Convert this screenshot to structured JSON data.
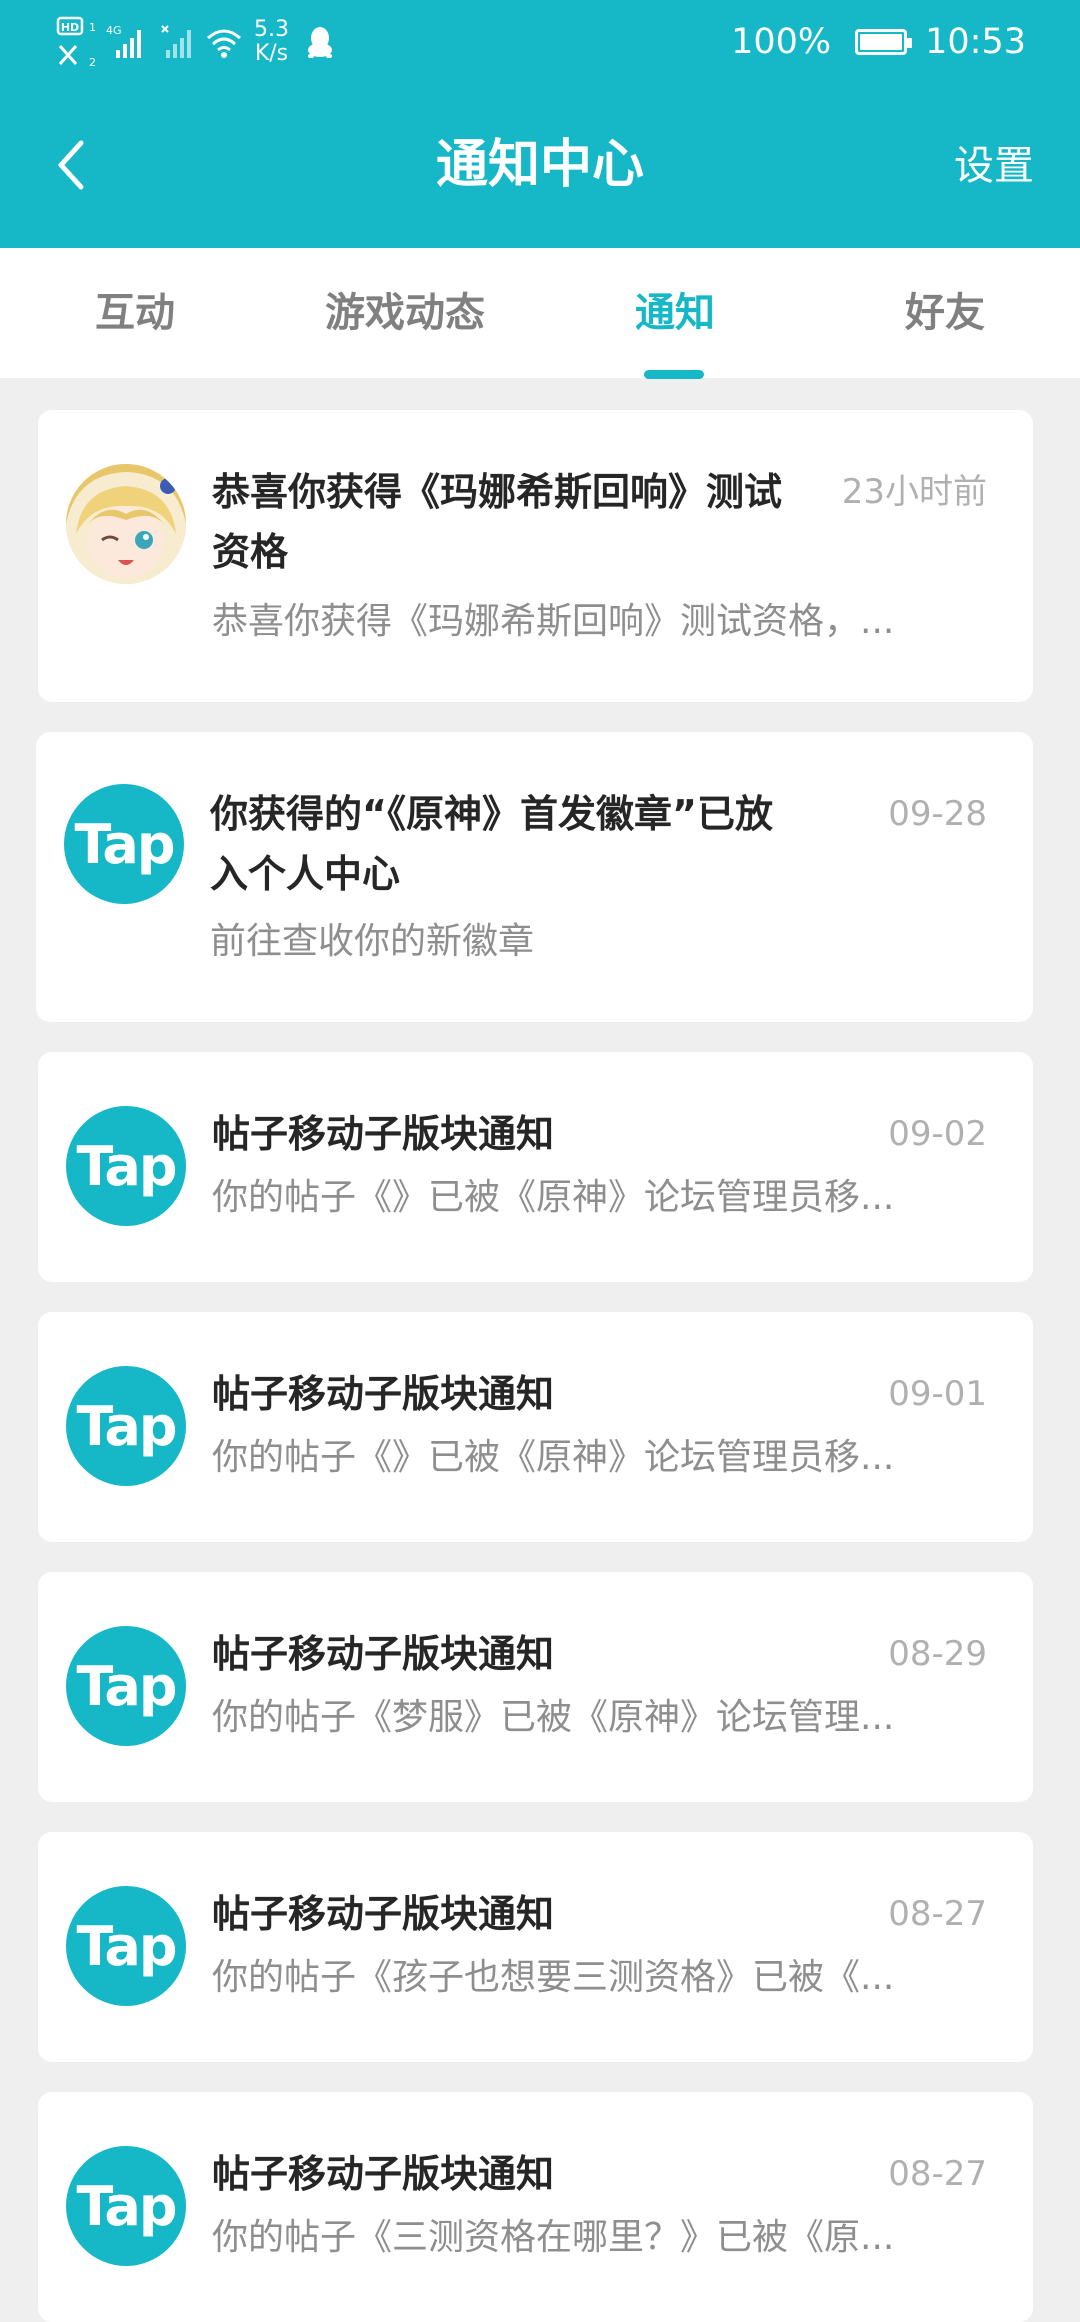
{
  "status_bar": {
    "hd_label": "HD",
    "network_label": "4G",
    "speed_value": "5.3",
    "speed_unit": "K/s",
    "battery_percent": "100%",
    "battery_level": 1.0,
    "time": "10:53"
  },
  "navbar": {
    "title": "通知中心",
    "settings_label": "设置"
  },
  "tabs": [
    {
      "label": "互动"
    },
    {
      "label": "游戏动态"
    },
    {
      "label": "通知",
      "active": true
    },
    {
      "label": "好友"
    }
  ],
  "colors": {
    "accent": "#16b8c7",
    "background": "#efefef",
    "title_text": "#262626",
    "secondary_text": "#8e8e8e",
    "time_text": "#b0b0b0"
  },
  "notifications": [
    {
      "avatar": "anime-avatar",
      "title": "恭喜你获得《玛娜希斯回响》测试资格",
      "time": "23小时前",
      "desc": "恭喜你获得《玛娜希斯回响》测试资格，..."
    },
    {
      "avatar": "Tap",
      "title": "你获得的“《原神》首发徽章”已放入个人中心",
      "time": "09-28",
      "desc": "前往查收你的新徽章"
    },
    {
      "avatar": "Tap",
      "title": "帖子移动子版块通知",
      "time": "09-02",
      "desc": "你的帖子《》已被《原神》论坛管理员移..."
    },
    {
      "avatar": "Tap",
      "title": "帖子移动子版块通知",
      "time": "09-01",
      "desc": "你的帖子《》已被《原神》论坛管理员移..."
    },
    {
      "avatar": "Tap",
      "title": "帖子移动子版块通知",
      "time": "08-29",
      "desc": "你的帖子《梦服》已被《原神》论坛管理..."
    },
    {
      "avatar": "Tap",
      "title": "帖子移动子版块通知",
      "time": "08-27",
      "desc": "你的帖子《孩子也想要三测资格》已被《..."
    },
    {
      "avatar": "Tap",
      "title": "帖子移动子版块通知",
      "time": "08-27",
      "desc": "你的帖子《三测资格在哪里？》已被《原..."
    }
  ]
}
